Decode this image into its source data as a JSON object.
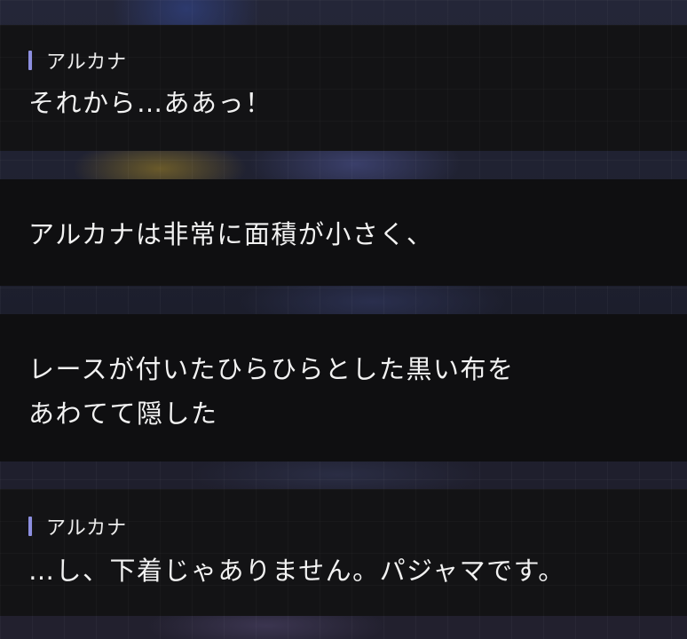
{
  "dialogue": [
    {
      "speaker": "アルカナ",
      "lines": [
        "それから…ああっ！"
      ]
    },
    {
      "speaker": "",
      "lines": [
        "アルカナは非常に面積が小さく、"
      ]
    },
    {
      "speaker": "",
      "lines": [
        "レースが付いたひらひらとした黒い布を",
        "あわてて隠した"
      ]
    },
    {
      "speaker": "アルカナ",
      "lines": [
        "…し、下着じゃありません。パジャマです。"
      ]
    }
  ],
  "colors": {
    "panel_bg": "#0f0f11",
    "speaker_accent": "#8d8fe0",
    "text": "#f2f2f2"
  }
}
